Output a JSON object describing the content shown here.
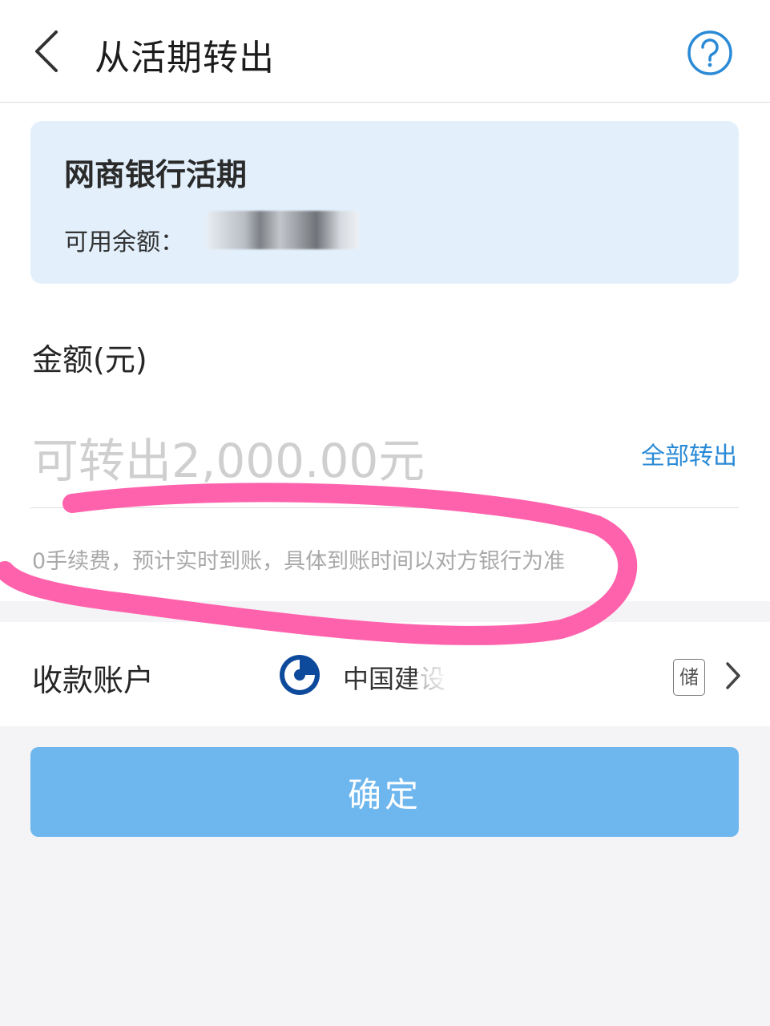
{
  "header": {
    "title": "从活期转出",
    "back_icon": "chevron-left-icon",
    "help_icon": "question-circle-icon"
  },
  "account_card": {
    "name": "网商银行活期",
    "balance_label": "可用余额："
  },
  "amount": {
    "label": "金额(元)",
    "placeholder": "可转出2,000.00元",
    "value": "",
    "transfer_all_label": "全部转出",
    "fee_note": "0手续费，预计实时到账，具体到账时间以对方银行为准"
  },
  "receiving_account": {
    "label": "收款账户",
    "bank_name": "中国建设",
    "card_type_badge": "储",
    "bank_logo_icon": "ccb-logo-icon",
    "chevron_icon": "chevron-right-icon"
  },
  "confirm_button": {
    "label": "确定"
  },
  "colors": {
    "accent": "#2a8ad6",
    "card_bg": "#e3f0fc",
    "confirm_bg": "#6eb6ee",
    "annotation": "#ff5aa8"
  }
}
